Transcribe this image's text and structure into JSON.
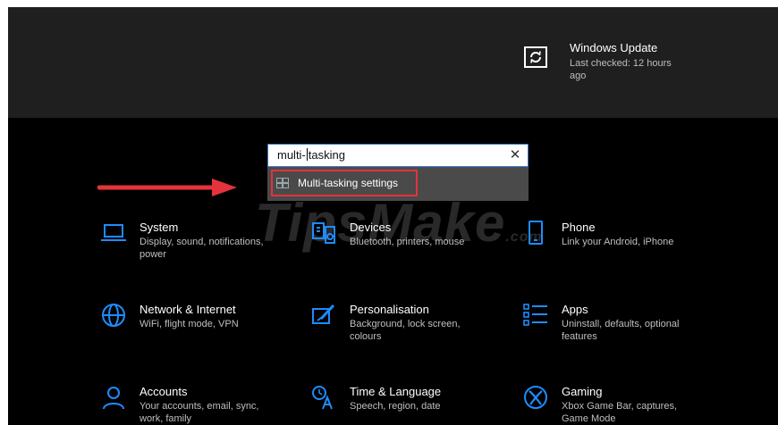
{
  "header": {
    "update_title": "Windows Update",
    "update_status": "Last checked: 12 hours ago",
    "update_icon": "refresh-icon"
  },
  "search": {
    "value_before_caret": "multi-",
    "value_after_caret": "tasking",
    "clear_glyph": "✕",
    "suggestion": "Multi-tasking settings"
  },
  "watermark": {
    "text": "TipsMake",
    "suffix": ".com"
  },
  "colors": {
    "accent": "#1e8cff",
    "highlight_border": "#e4333b",
    "arrow": "#e4333b",
    "header_bg": "#1f1f1f",
    "page_bg": "#000000"
  },
  "tiles": [
    {
      "title": "System",
      "desc": "Display, sound, notifications, power",
      "icon": "laptop-icon"
    },
    {
      "title": "Devices",
      "desc": "Bluetooth, printers, mouse",
      "icon": "devices-icon"
    },
    {
      "title": "Phone",
      "desc": "Link your Android, iPhone",
      "icon": "phone-icon"
    },
    {
      "title": "Network & Internet",
      "desc": "WiFi, flight mode, VPN",
      "icon": "globe-icon"
    },
    {
      "title": "Personalisation",
      "desc": "Background, lock screen, colours",
      "icon": "paint-icon"
    },
    {
      "title": "Apps",
      "desc": "Uninstall, defaults, optional features",
      "icon": "apps-list-icon"
    },
    {
      "title": "Accounts",
      "desc": "Your accounts, email, sync, work, family",
      "icon": "person-icon"
    },
    {
      "title": "Time & Language",
      "desc": "Speech, region, date",
      "icon": "time-language-icon"
    },
    {
      "title": "Gaming",
      "desc": "Xbox Game Bar, captures, Game Mode",
      "icon": "xbox-icon"
    }
  ]
}
